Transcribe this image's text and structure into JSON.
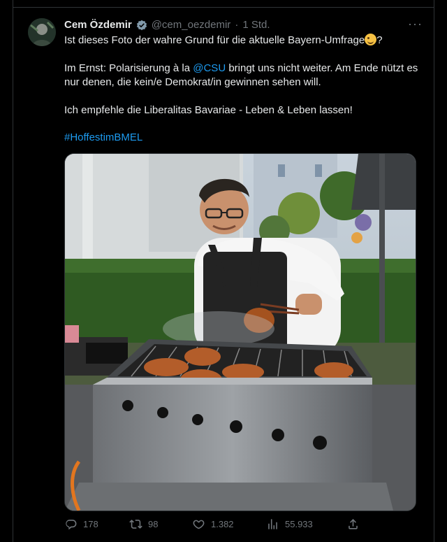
{
  "tweet": {
    "author_name": "Cem Özdemir",
    "handle": "@cem_oezdemir",
    "separator": "·",
    "time": "1 Std.",
    "more_label": "···",
    "line1": "Ist dieses Foto der wahre Grund für die aktuelle Bayern-Umfrage",
    "line1_end": "?",
    "p2_before": "Im Ernst: Polarisierung à la ",
    "p2_mention": "@CSU",
    "p2_after": " bringt uns nicht weiter. Am Ende nützt es nur denen, die kein/e Demokrat/in gewinnen sehen will.",
    "p3": "Ich empfehle die Liberalitas Bavariae - Leben & Leben lassen!",
    "hashtag": "#HoffestimBMEL"
  },
  "icons": {
    "verified": "verified-badge-icon",
    "reply": "reply-icon",
    "retweet": "retweet-icon",
    "like": "heart-icon",
    "views": "views-icon",
    "share": "share-icon"
  },
  "metrics": {
    "replies": "178",
    "retweets": "98",
    "likes": "1.382",
    "views": "55.933"
  },
  "colors": {
    "background": "#000000",
    "text": "#e7e9ea",
    "secondary": "#71767b",
    "link": "#1d9bf0",
    "border": "#2f3336"
  }
}
